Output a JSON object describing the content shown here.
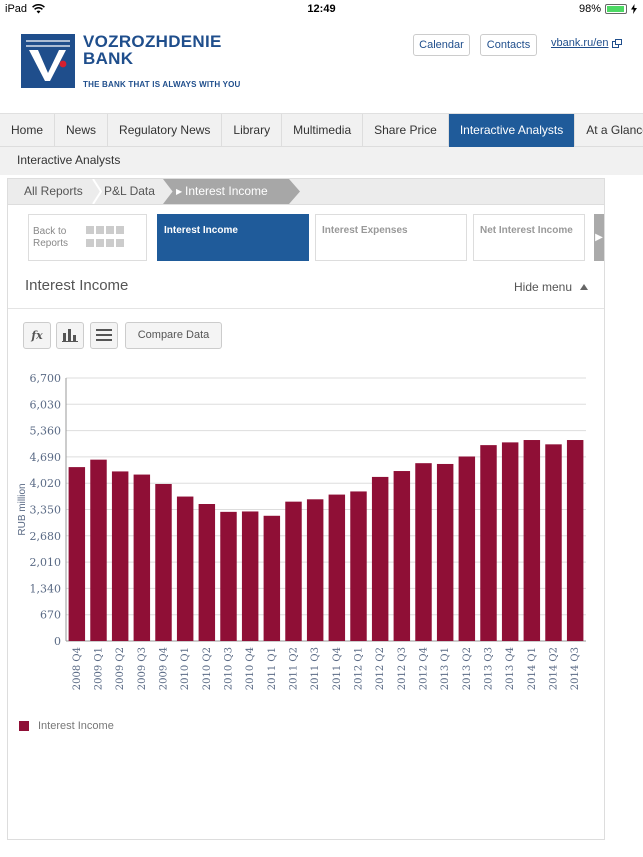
{
  "status_bar": {
    "device": "iPad",
    "time": "12:49",
    "battery": "98%"
  },
  "header": {
    "brand_line1": "VOZROZHDENIE",
    "brand_line2": "BANK",
    "tagline": "THE BANK THAT IS ALWAYS WITH YOU",
    "calendar_label": "Calendar",
    "contacts_label": "Contacts",
    "site_link": "vbank.ru/en"
  },
  "nav": {
    "items": [
      "Home",
      "News",
      "Regulatory News",
      "Library",
      "Multimedia",
      "Share Price",
      "Interactive Analysts",
      "At a Glance"
    ],
    "active_index": 6
  },
  "subnav": {
    "label": "Interactive Analysts"
  },
  "breadcrumbs": [
    "All Reports",
    "P&L Data",
    "Interest Income"
  ],
  "cards": {
    "back_line1": "Back to",
    "back_line2": "Reports",
    "items": [
      "Interest Income",
      "Interest Expenses",
      "Net Interest Income"
    ],
    "active_index": 0
  },
  "panel": {
    "title": "Interest Income",
    "hide_menu": "Hide menu"
  },
  "toolbar": {
    "fx_label": "fx",
    "compare_label": "Compare Data"
  },
  "colors": {
    "accent": "#1f5b9a",
    "bar": "#8f0f36"
  },
  "icons": {
    "wifi": "wifi-icon",
    "battery": "battery-icon",
    "external": "external-link-icon",
    "chart": "bar-chart-icon",
    "table": "table-icon",
    "formula": "formula-icon"
  },
  "chart_data": {
    "type": "bar",
    "ylabel": "RUB million",
    "xlabel": "",
    "ylim": [
      0,
      6700
    ],
    "yticks": [
      0,
      670,
      1340,
      2010,
      2680,
      3350,
      4020,
      4690,
      5360,
      6030,
      6700
    ],
    "ytick_labels": [
      "0",
      "670",
      "1,340",
      "2,010",
      "2,680",
      "3,350",
      "4,020",
      "4,690",
      "5,360",
      "6,030",
      "6,700"
    ],
    "grid": true,
    "categories": [
      "2008 Q4",
      "2009 Q1",
      "2009 Q2",
      "2009 Q3",
      "2009 Q4",
      "2010 Q1",
      "2010 Q2",
      "2010 Q3",
      "2010 Q4",
      "2011 Q1",
      "2011 Q2",
      "2011 Q3",
      "2011 Q4",
      "2012 Q1",
      "2012 Q2",
      "2012 Q3",
      "2012 Q4",
      "2013 Q1",
      "2013 Q2",
      "2013 Q3",
      "2013 Q4",
      "2014 Q1",
      "2014 Q2",
      "2014 Q3"
    ],
    "series": [
      {
        "name": "Interest Income",
        "values": [
          4430,
          4620,
          4320,
          4240,
          4000,
          3680,
          3490,
          3290,
          3300,
          3190,
          3550,
          3610,
          3730,
          3810,
          4180,
          4330,
          4530,
          4510,
          4700,
          4990,
          5060,
          5120,
          5010,
          5120
        ]
      }
    ],
    "legend_position": "bottom-left"
  }
}
